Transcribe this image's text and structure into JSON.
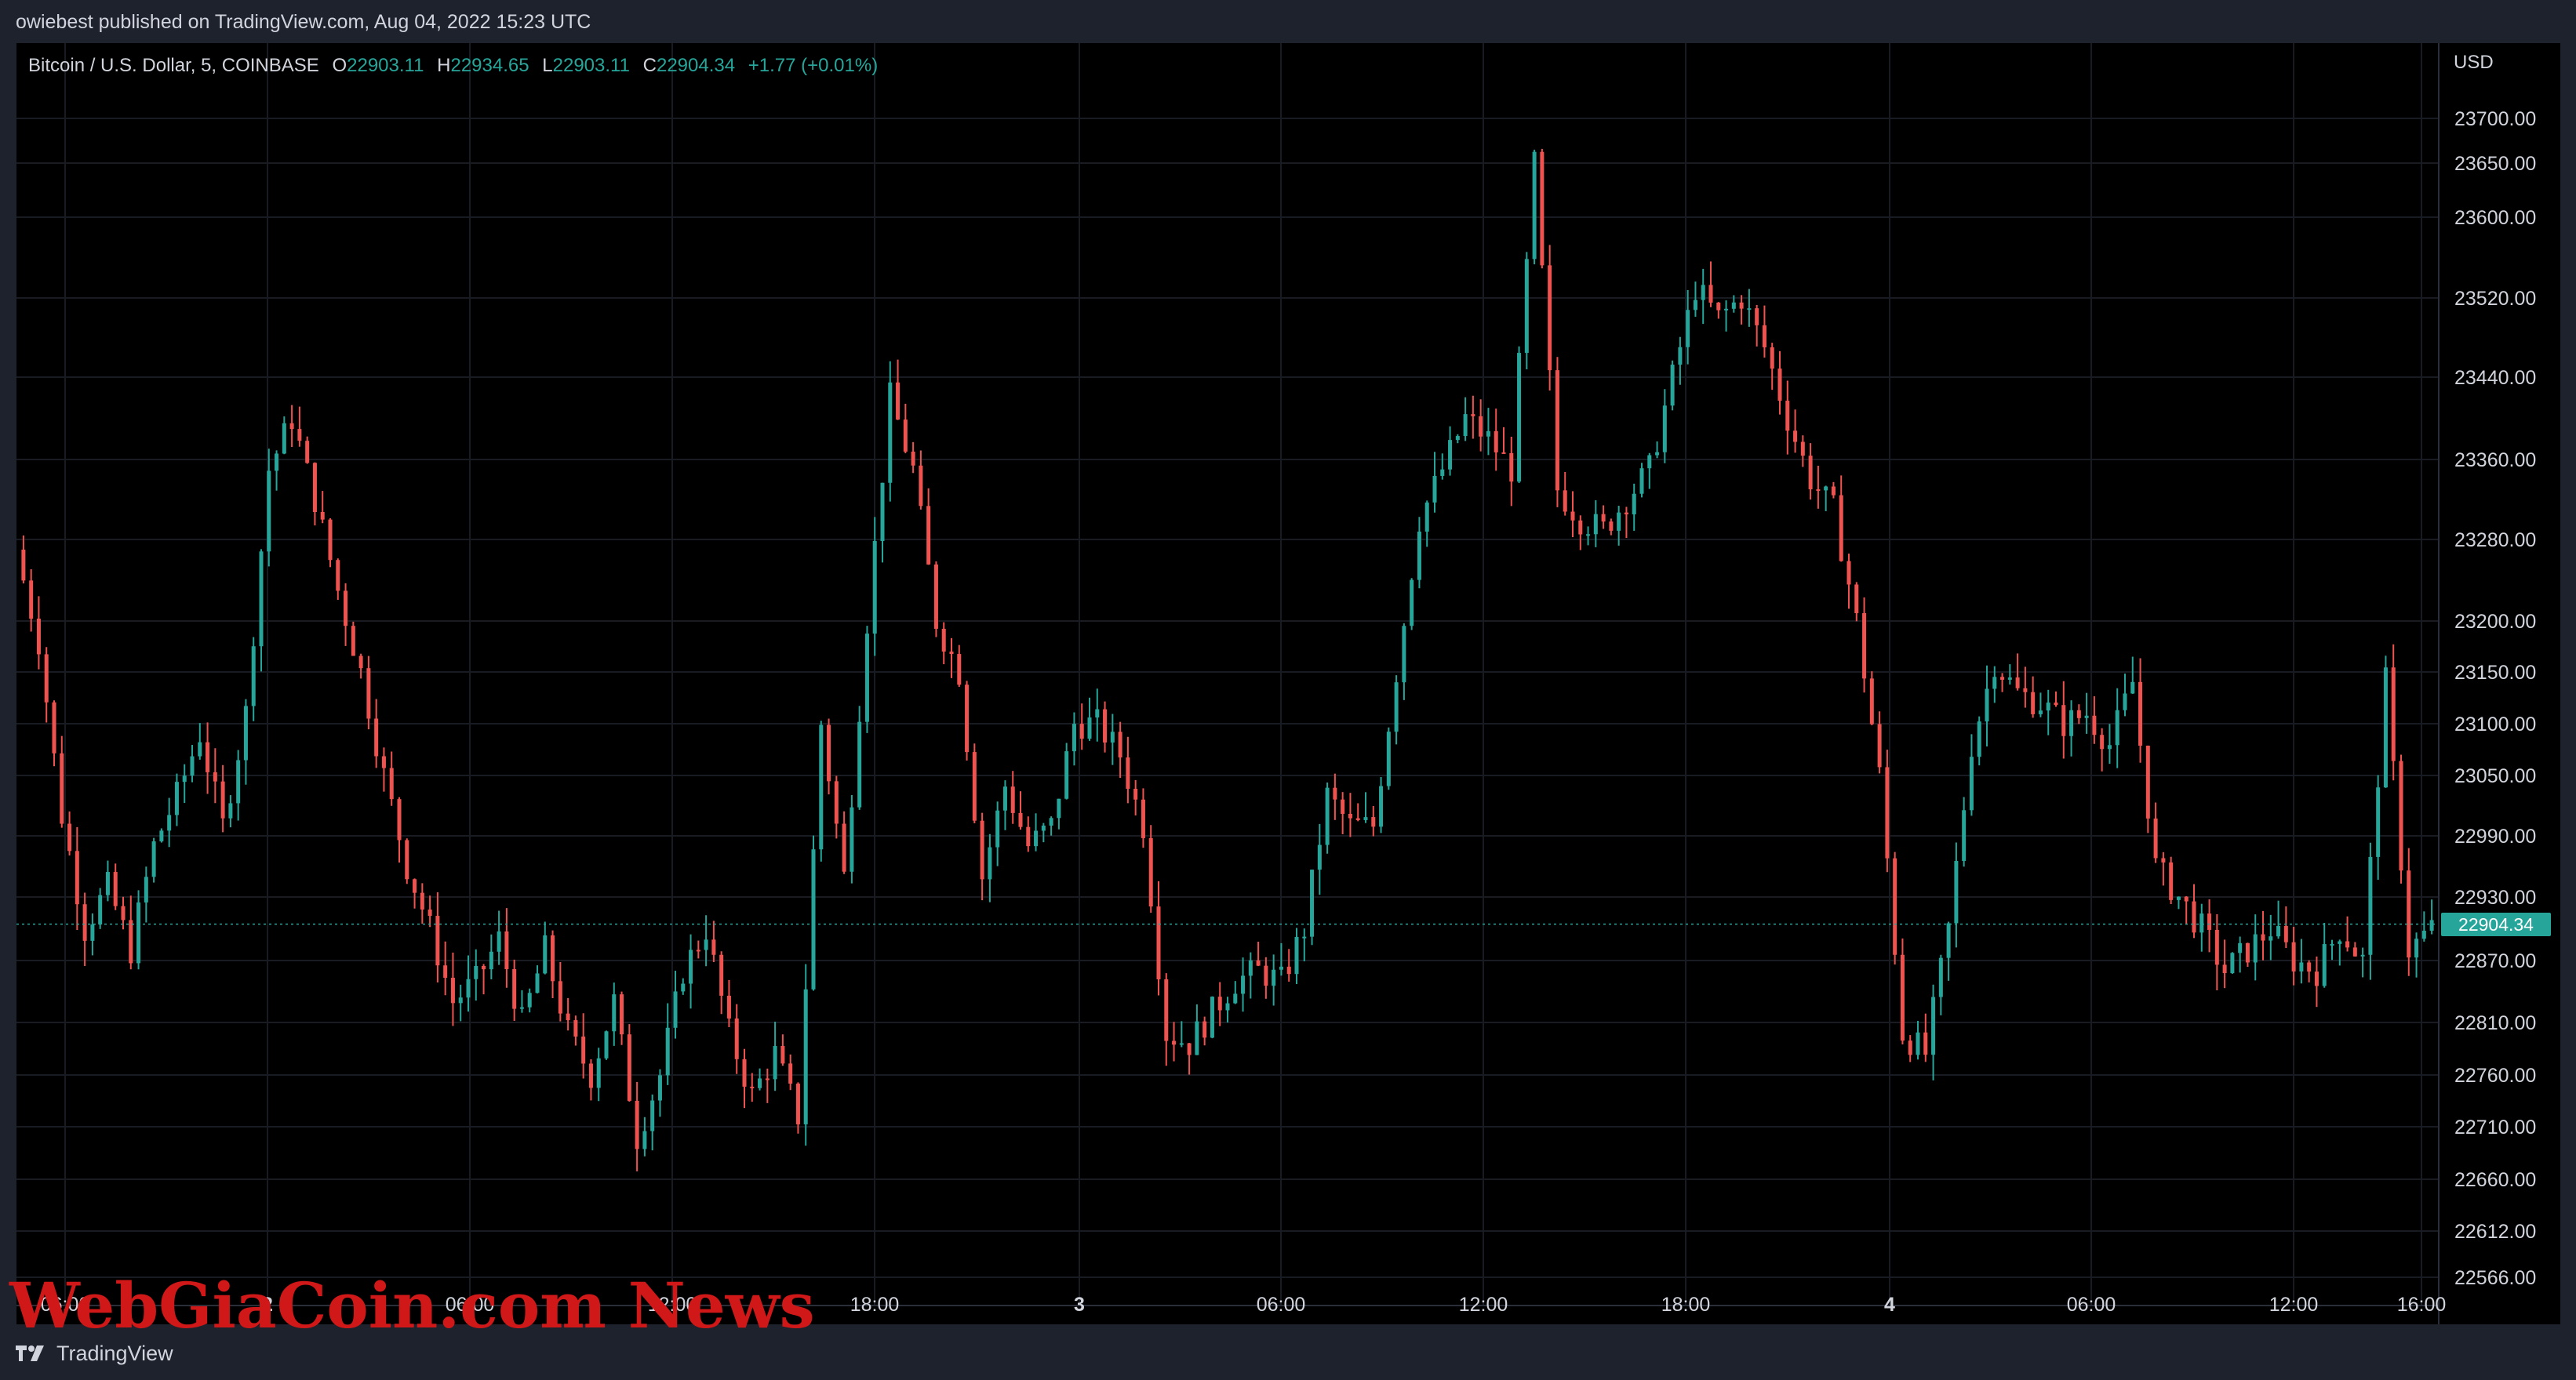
{
  "caption": "owiebest published on TradingView.com, Aug 04, 2022 15:23 UTC",
  "legend": {
    "symbol": "Bitcoin / U.S. Dollar, 5, COINBASE",
    "o_label": "O",
    "o": "22903.11",
    "h_label": "H",
    "h": "22934.65",
    "l_label": "L",
    "l": "22903.11",
    "c_label": "C",
    "c": "22904.34",
    "change": "+1.77 (+0.01%)"
  },
  "currency": "USD",
  "last_price": "22904.34",
  "watermark": "WebGiaCoin.com News",
  "footer": "TradingView",
  "colors": {
    "up": "#26a69a",
    "down": "#ef5350",
    "background": "#000000",
    "frame": "#1e222d",
    "text": "#d1d4dc"
  },
  "chart_data": {
    "type": "candlestick",
    "interval": "5",
    "exchange": "COINBASE",
    "y_tick_labels": [
      "23700.00",
      "23650.00",
      "23600.00",
      "23520.00",
      "23440.00",
      "23360.00",
      "23280.00",
      "23200.00",
      "23150.00",
      "23100.00",
      "23050.00",
      "22990.00",
      "22930.00",
      "22870.00",
      "22810.00",
      "22760.00",
      "22710.00",
      "22660.00",
      "22612.00",
      "22566.00"
    ],
    "x_tick_labels": [
      "06:00",
      "2",
      "06:00",
      "12:00",
      "18:00",
      "3",
      "06:00",
      "12:00",
      "18:00",
      "4",
      "06:00",
      "12:00",
      "16:00"
    ],
    "ylim": [
      22560,
      23730
    ],
    "close_path": [
      [
        0,
        23270
      ],
      [
        3,
        23180
      ],
      [
        6,
        23010
      ],
      [
        9,
        22900
      ],
      [
        12,
        22940
      ],
      [
        15,
        22880
      ],
      [
        18,
        22980
      ],
      [
        21,
        23030
      ],
      [
        24,
        23090
      ],
      [
        27,
        23000
      ],
      [
        30,
        23110
      ],
      [
        33,
        23350
      ],
      [
        36,
        23400
      ],
      [
        39,
        23320
      ],
      [
        42,
        23230
      ],
      [
        45,
        23150
      ],
      [
        48,
        23050
      ],
      [
        51,
        22960
      ],
      [
        54,
        22900
      ],
      [
        57,
        22830
      ],
      [
        60,
        22850
      ],
      [
        63,
        22890
      ],
      [
        66,
        22810
      ],
      [
        69,
        22880
      ],
      [
        72,
        22800
      ],
      [
        75,
        22760
      ],
      [
        78,
        22830
      ],
      [
        81,
        22700
      ],
      [
        84,
        22760
      ],
      [
        87,
        22860
      ],
      [
        90,
        22900
      ],
      [
        93,
        22800
      ],
      [
        96,
        22740
      ],
      [
        99,
        22780
      ],
      [
        102,
        22720
      ],
      [
        105,
        23100
      ],
      [
        108,
        22950
      ],
      [
        111,
        23200
      ],
      [
        114,
        23420
      ],
      [
        117,
        23350
      ],
      [
        120,
        23200
      ],
      [
        123,
        23150
      ],
      [
        126,
        22950
      ],
      [
        129,
        23040
      ],
      [
        132,
        22980
      ],
      [
        135,
        23000
      ],
      [
        138,
        23100
      ],
      [
        141,
        23100
      ],
      [
        144,
        23070
      ],
      [
        147,
        23000
      ],
      [
        150,
        22800
      ],
      [
        153,
        22790
      ],
      [
        156,
        22820
      ],
      [
        159,
        22850
      ],
      [
        162,
        22860
      ],
      [
        165,
        22850
      ],
      [
        168,
        22900
      ],
      [
        171,
        23030
      ],
      [
        174,
        23000
      ],
      [
        177,
        23000
      ],
      [
        180,
        23150
      ],
      [
        183,
        23300
      ],
      [
        186,
        23350
      ],
      [
        189,
        23400
      ],
      [
        192,
        23380
      ],
      [
        195,
        23350
      ],
      [
        198,
        23650
      ],
      [
        201,
        23330
      ],
      [
        204,
        23300
      ],
      [
        207,
        23290
      ],
      [
        210,
        23320
      ],
      [
        213,
        23350
      ],
      [
        216,
        23440
      ],
      [
        219,
        23530
      ],
      [
        222,
        23500
      ],
      [
        225,
        23520
      ],
      [
        228,
        23470
      ],
      [
        231,
        23400
      ],
      [
        234,
        23340
      ],
      [
        237,
        23310
      ],
      [
        240,
        23200
      ],
      [
        243,
        23050
      ],
      [
        246,
        22800
      ],
      [
        249,
        22780
      ],
      [
        252,
        22900
      ],
      [
        255,
        23080
      ],
      [
        258,
        23160
      ],
      [
        261,
        23130
      ],
      [
        264,
        23120
      ],
      [
        267,
        23100
      ],
      [
        270,
        23110
      ],
      [
        273,
        23080
      ],
      [
        276,
        23140
      ],
      [
        279,
        22960
      ],
      [
        282,
        22930
      ],
      [
        285,
        22900
      ],
      [
        288,
        22860
      ],
      [
        291,
        22880
      ],
      [
        294,
        22900
      ],
      [
        297,
        22870
      ],
      [
        300,
        22860
      ],
      [
        303,
        22900
      ],
      [
        306,
        22870
      ],
      [
        309,
        23140
      ],
      [
        312,
        22880
      ],
      [
        315,
        22900
      ]
    ],
    "range_high": 23650,
    "range_low": 22660,
    "last_close": 22904.34
  }
}
